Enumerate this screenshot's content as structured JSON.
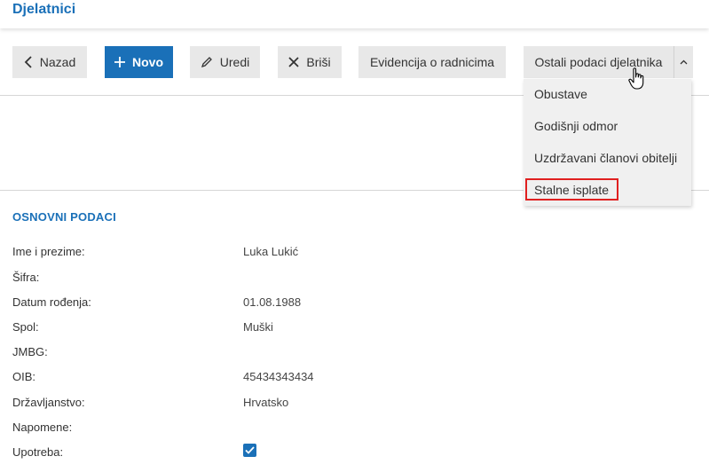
{
  "header": {
    "title": "Djelatnici"
  },
  "toolbar": {
    "back_label": "Nazad",
    "new_label": "Novo",
    "edit_label": "Uredi",
    "delete_label": "Briši",
    "records_label": "Evidencija o radnicima",
    "other_label": "Ostali podaci djelatnika"
  },
  "dropdown": {
    "items": [
      {
        "label": "Obustave"
      },
      {
        "label": "Godišnji odmor"
      },
      {
        "label": "Uzdržavani članovi obitelji"
      },
      {
        "label": "Stalne isplate"
      }
    ]
  },
  "section": {
    "title": "OSNOVNI PODACI",
    "fields": [
      {
        "label": "Ime i prezime:",
        "value": "Luka Lukić"
      },
      {
        "label": "Šifra:",
        "value": ""
      },
      {
        "label": "Datum rođenja:",
        "value": "01.08.1988"
      },
      {
        "label": "Spol:",
        "value": "Muški"
      },
      {
        "label": "JMBG:",
        "value": ""
      },
      {
        "label": "OIB:",
        "value": "45434343434"
      },
      {
        "label": "Državljanstvo:",
        "value": "Hrvatsko"
      },
      {
        "label": "Napomene:",
        "value": ""
      },
      {
        "label": "Upotreba:",
        "value": ""
      }
    ],
    "upotreba_checked": true
  },
  "colors": {
    "accent": "#1a70b8",
    "highlight": "#e02020"
  }
}
